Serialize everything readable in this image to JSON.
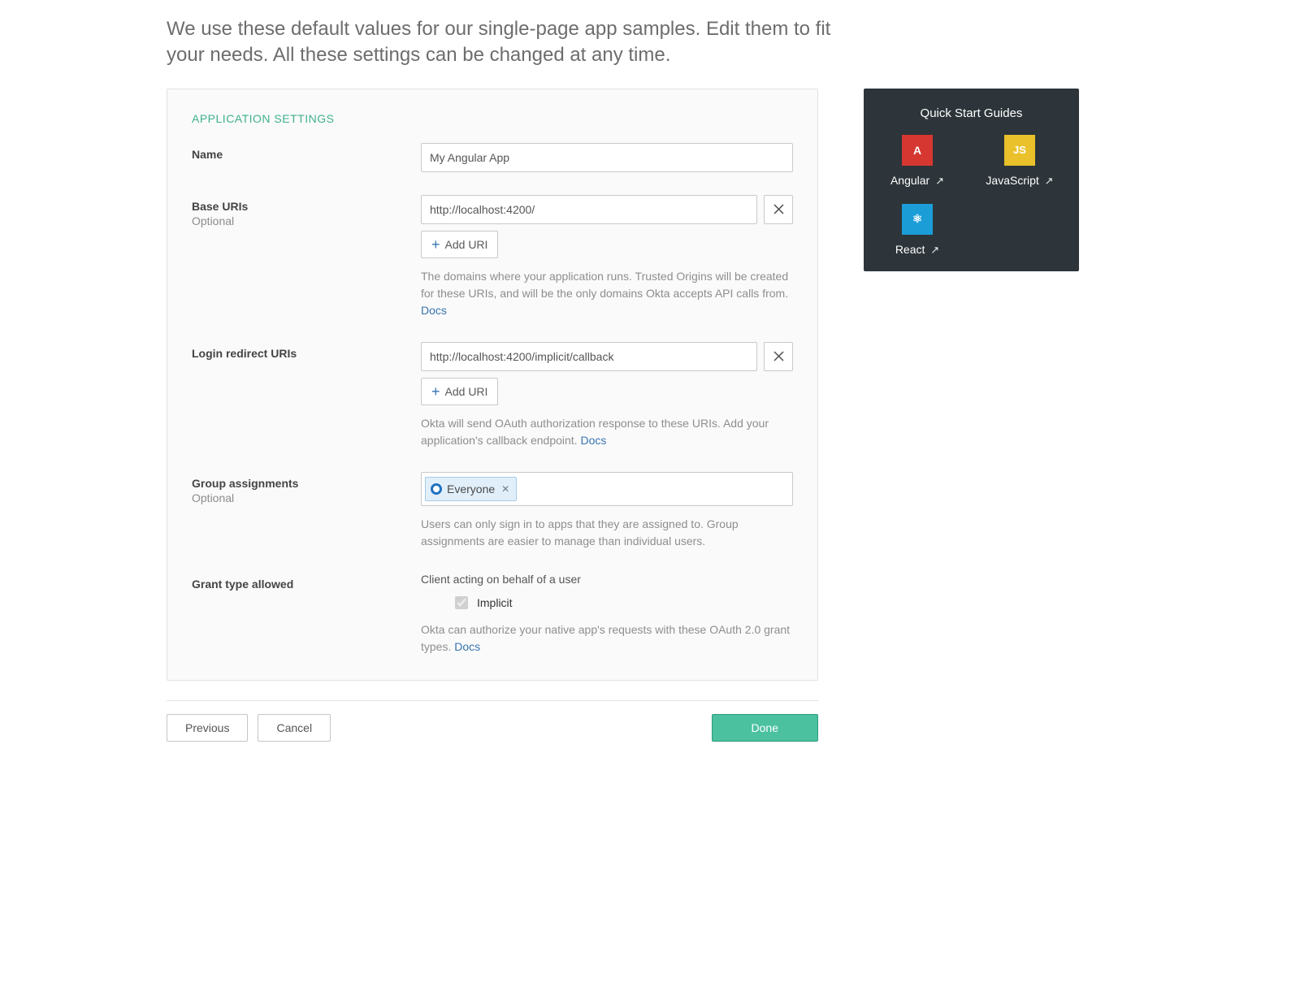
{
  "intro": "We use these default values for our single-page app samples. Edit them to fit your needs. All these settings can be changed at any time.",
  "panel": {
    "title": "APPLICATION SETTINGS",
    "name_label": "Name",
    "name_value": "My Angular App",
    "base_uris_label": "Base URIs",
    "optional_label": "Optional",
    "base_uri_value": "http://localhost:4200/",
    "add_uri_label": "Add URI",
    "base_uris_help": "The domains where your application runs. Trusted Origins will be created for these URIs, and will be the only domains Okta accepts API calls from. ",
    "docs_label": "Docs",
    "login_redirect_label": "Login redirect URIs",
    "login_redirect_value": "http://localhost:4200/implicit/callback",
    "login_help": "Okta will send OAuth authorization response to these URIs. Add your application's callback endpoint. ",
    "group_label": "Group assignments",
    "group_token": "Everyone",
    "group_help": "Users can only sign in to apps that they are assigned to. Group assignments are easier to manage than individual users.",
    "grant_label": "Grant type allowed",
    "grant_sub": "Client acting on behalf of a user",
    "grant_implicit": "Implicit",
    "grant_help": "Okta can authorize your native app's requests with these OAuth 2.0 grant types. "
  },
  "actions": {
    "previous": "Previous",
    "cancel": "Cancel",
    "done": "Done"
  },
  "sidebar": {
    "title": "Quick Start Guides",
    "guides": [
      {
        "label": "Angular",
        "tile_text": "A",
        "tile_class": "angular"
      },
      {
        "label": "JavaScript",
        "tile_text": "JS",
        "tile_class": "js"
      },
      {
        "label": "React",
        "tile_text": "⚛",
        "tile_class": "react"
      }
    ]
  }
}
